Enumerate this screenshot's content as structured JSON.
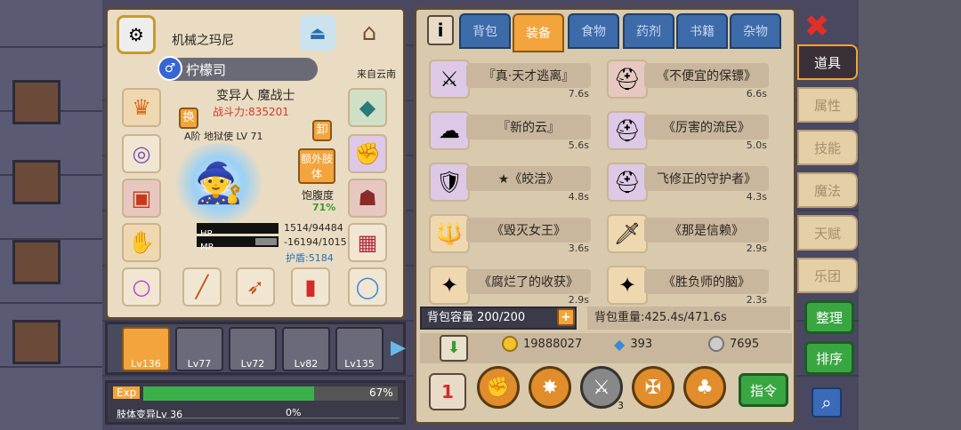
{
  "character": {
    "title": "机械之玛尼",
    "name": "柠檬司",
    "gender_symbol": "♂",
    "origin": "来自云南",
    "class": "变异人 魔战士",
    "power": "战斗力:835201",
    "rank": "A阶 地狱使",
    "rank_lv": "LV 71",
    "swap_btn": "换",
    "unequip_btn": "卸",
    "extra_limb_btn": "额外肢体",
    "satiety_label": "饱腹度",
    "satiety_value": "71%",
    "hp_label": "HP",
    "hp_value": "1514/94484",
    "mp_label": "MP",
    "mp_value": "-16194/1015",
    "shield": "护盾:5184"
  },
  "heroes": [
    {
      "lv": "Lv136",
      "selected": true
    },
    {
      "lv": "Lv77"
    },
    {
      "lv": "Lv72"
    },
    {
      "lv": "Lv82"
    },
    {
      "lv": "Lv135"
    }
  ],
  "exp": {
    "label": "Exp",
    "percent": "67%",
    "fill": 0.67,
    "limb_label": "肢体变异Lv 36",
    "limb_percent": "0%"
  },
  "tabs": [
    "背包",
    "装备",
    "食物",
    "药剂",
    "书籍",
    "杂物"
  ],
  "active_tab": "装备",
  "items_left": [
    {
      "name": "『真·天才逃离』",
      "weight": "7.6s",
      "icon": "⚔",
      "color": "purple"
    },
    {
      "name": "『新的云』",
      "weight": "5.6s",
      "icon": "☁",
      "color": "purple"
    },
    {
      "name": "★《皎洁》",
      "weight": "4.8s",
      "icon": "🛡",
      "color": "purple"
    },
    {
      "name": "《毁灭女王》",
      "weight": "3.6s",
      "icon": "🔱",
      "color": "orange"
    },
    {
      "name": "《腐烂了的收获》",
      "weight": "2.9s",
      "icon": "✦",
      "color": "orange"
    }
  ],
  "items_right": [
    {
      "name": "《不便宜的保镖》",
      "weight": "6.6s",
      "icon": "⛑",
      "color": "red"
    },
    {
      "name": "《厉害的流民》",
      "weight": "5.0s",
      "icon": "⛑",
      "color": "purple"
    },
    {
      "name": "飞修正的守护者》",
      "weight": "4.3s",
      "icon": "⛑",
      "color": "purple"
    },
    {
      "name": "《那是信赖》",
      "weight": "2.9s",
      "icon": "🗡",
      "color": "orange"
    },
    {
      "name": "《胜负师的脑》",
      "weight": "2.3s",
      "icon": "✦",
      "color": "orange"
    }
  ],
  "bag": {
    "capacity": "背包容量 200/200",
    "weight": "背包重量:425.4s/471.6s",
    "plus": "+"
  },
  "currency": {
    "gold": "19888027",
    "diamond": "393",
    "silver": "7695"
  },
  "side_tabs": [
    "道具",
    "属性",
    "技能",
    "魔法",
    "天赋",
    "乐团"
  ],
  "active_side": "道具",
  "buttons": {
    "organize": "整理",
    "sort": "排序",
    "command": "指令",
    "close": "✖",
    "info": "i"
  },
  "action_badge": "3",
  "colors": {
    "accent": "#f3a43c",
    "tab_blue": "#3d6aa8",
    "green": "#39a642"
  }
}
